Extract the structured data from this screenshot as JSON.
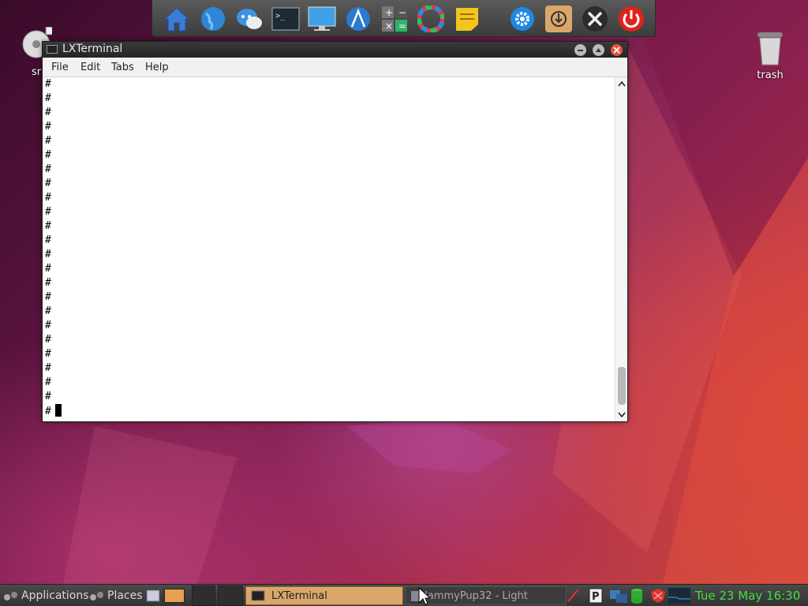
{
  "desktop": {
    "left_icon_label": "sr",
    "trash_label": "trash"
  },
  "dock": {
    "icons": [
      "home-icon",
      "globe-icon",
      "chat-icon",
      "terminal-icon",
      "monitor-icon",
      "vector-icon",
      "calculator-icon",
      "color-wheel-icon",
      "notes-icon",
      "settings-icon",
      "install-icon",
      "tools-icon",
      "power-icon"
    ]
  },
  "window": {
    "title": "LXTerminal",
    "menu": {
      "file": "File",
      "edit": "Edit",
      "tabs": "Tabs",
      "help": "Help"
    },
    "terminal_lines": [
      "#",
      "#",
      "#",
      "#",
      "#",
      "#",
      "#",
      "#",
      "#",
      "#",
      "#",
      "#",
      "#",
      "#",
      "#",
      "#",
      "#",
      "#",
      "#",
      "#",
      "#",
      "#",
      "#",
      "#"
    ]
  },
  "taskbar": {
    "applications": "Applications",
    "places": "Places",
    "task_terminal": "LXTerminal",
    "task_other": "JammyPup32 - Light",
    "clock": "Tue 23 May 16:30"
  },
  "colors": {
    "clock": "#40e040",
    "active_task": "#d9a76a"
  }
}
